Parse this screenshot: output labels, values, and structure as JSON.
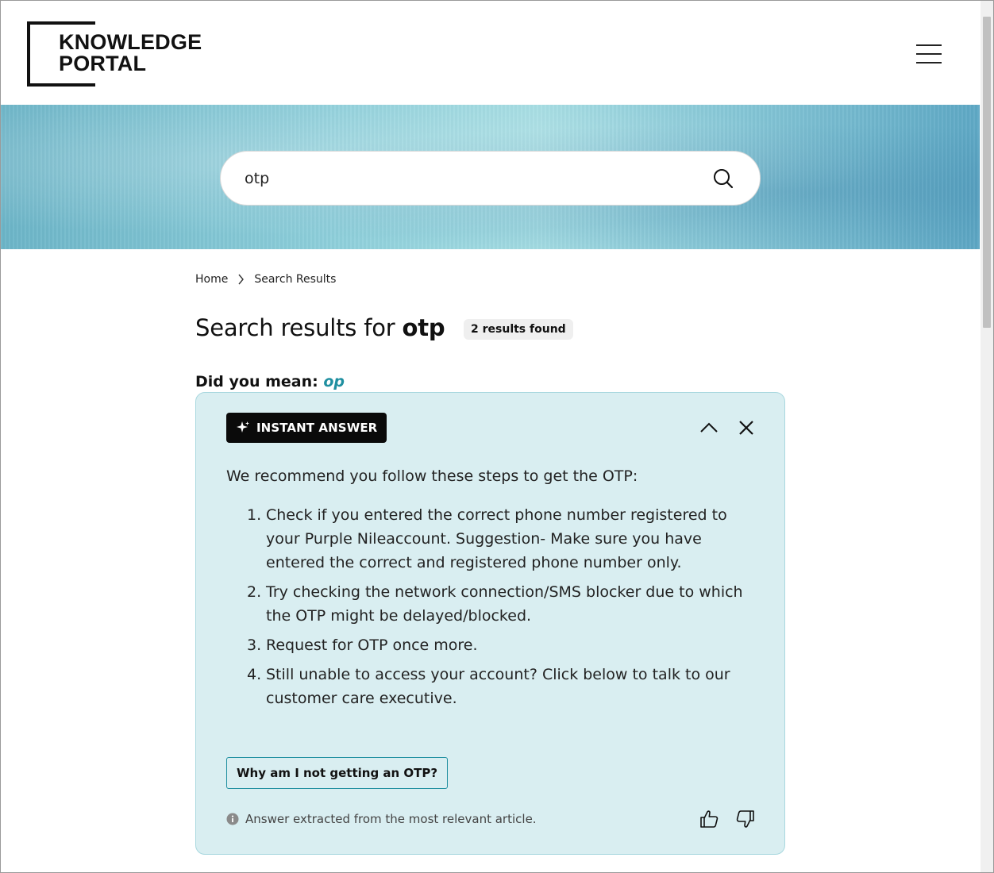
{
  "header": {
    "logo_line1": "KNOWLEDGE",
    "logo_line2": "PORTAL",
    "menu_icon": "hamburger-menu-icon"
  },
  "search": {
    "value": "otp",
    "icon": "search-icon"
  },
  "breadcrumb": {
    "home": "Home",
    "current": "Search Results"
  },
  "results": {
    "title_prefix": "Search results for",
    "query": "otp",
    "count_label": "2 results found",
    "did_you_mean_label": "Did you mean:",
    "did_you_mean_term": "op"
  },
  "instant_answer": {
    "label": "INSTANT ANSWER",
    "intro": "We recommend you follow these steps to get the OTP:",
    "steps": [
      {
        "num": "1.",
        "text": "Check if you entered the correct phone number registered to your Purple Nileaccount. Suggestion- Make sure you have entered the correct and registered phone number only."
      },
      {
        "num": "2.",
        "text": "Try checking the network connection/SMS blocker due to which the OTP might be delayed/blocked."
      },
      {
        "num": "3.",
        "text": "Request for OTP once more."
      },
      {
        "num": "4.",
        "text": "Still unable to access your account? Click below to talk to our customer care executive."
      }
    ],
    "cta_label": "Why am I not getting an OTP?",
    "footer_note": "Answer extracted from the most relevant article."
  },
  "colors": {
    "accent": "#1f8fa0",
    "card_bg": "#d9eef1",
    "card_border": "#a9d8df",
    "label_bg": "#0a0a0a"
  }
}
